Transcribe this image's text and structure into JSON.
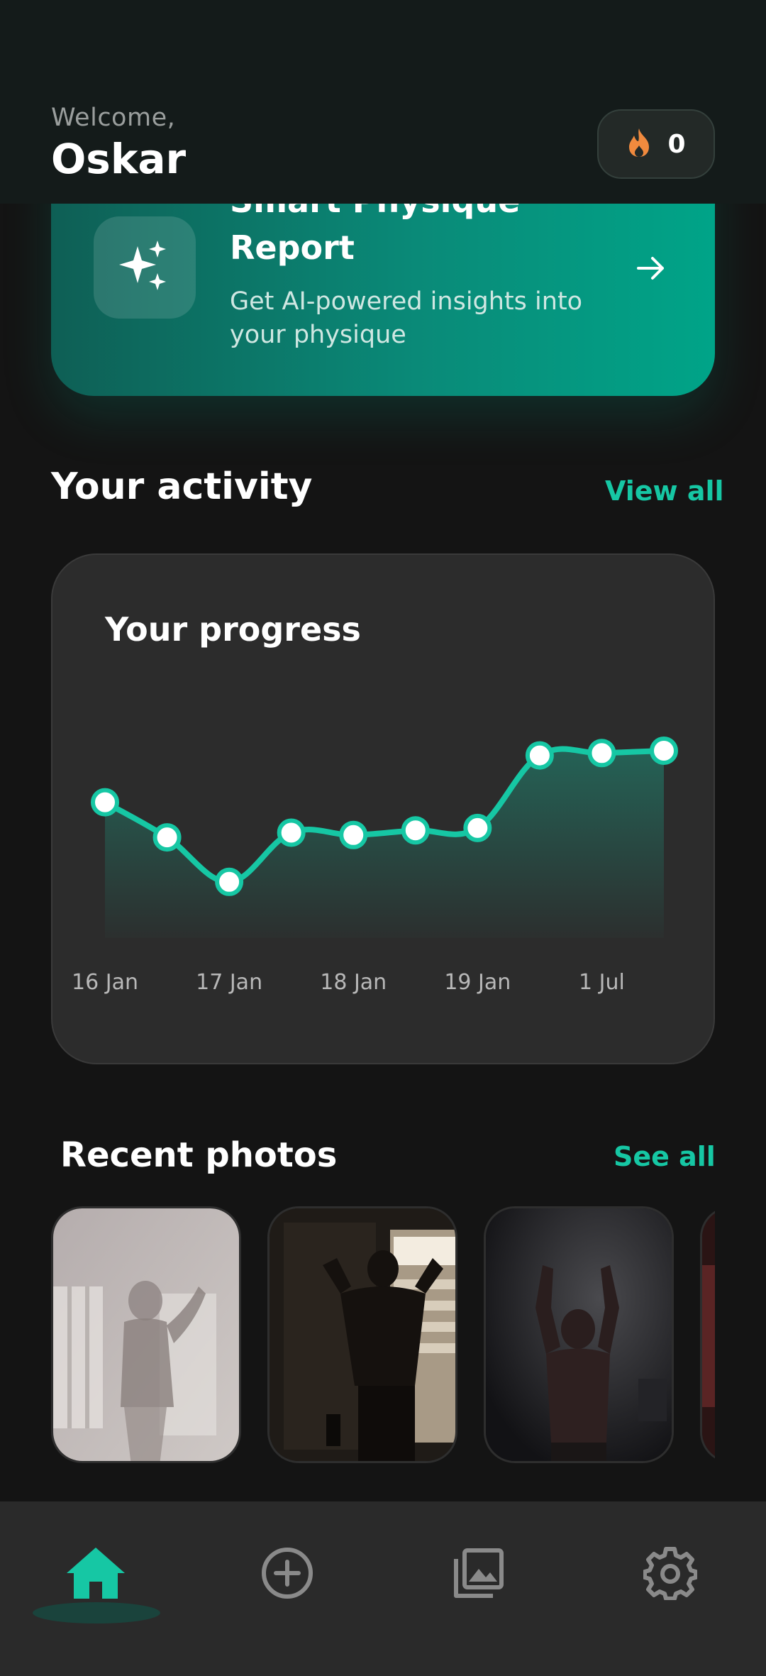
{
  "header": {
    "welcome": "Welcome,",
    "username": "Oskar",
    "streak_count": "0",
    "streak_icon": "flame-icon"
  },
  "report": {
    "title": "Smart Physique Report",
    "subtitle": "Get AI-powered insights into your physique",
    "icon": "sparkles-icon",
    "arrow_icon": "arrow-right-icon"
  },
  "activity": {
    "title": "Your activity",
    "link": "View all"
  },
  "chart_data": {
    "type": "line",
    "title": "Your progress",
    "x_tick_labels": [
      "16 Jan",
      "17 Jan",
      "18 Jan",
      "19 Jan",
      "1 Jul"
    ],
    "values": [
      0.58,
      0.43,
      0.24,
      0.45,
      0.44,
      0.46,
      0.47,
      0.78,
      0.79,
      0.8
    ],
    "ylim": [
      0,
      1
    ],
    "grid": false,
    "color": "#16c7a4"
  },
  "photos": {
    "title": "Recent photos",
    "link": "See all"
  },
  "nav": {
    "items": [
      {
        "icon": "home-icon",
        "active": true
      },
      {
        "icon": "add-circle-icon",
        "active": false
      },
      {
        "icon": "gallery-icon",
        "active": false
      },
      {
        "icon": "settings-gear-icon",
        "active": false
      }
    ]
  },
  "colors": {
    "accent": "#16c7a4",
    "background": "#141414",
    "card": "#2c2c2c",
    "flame": "#f08a3e"
  }
}
